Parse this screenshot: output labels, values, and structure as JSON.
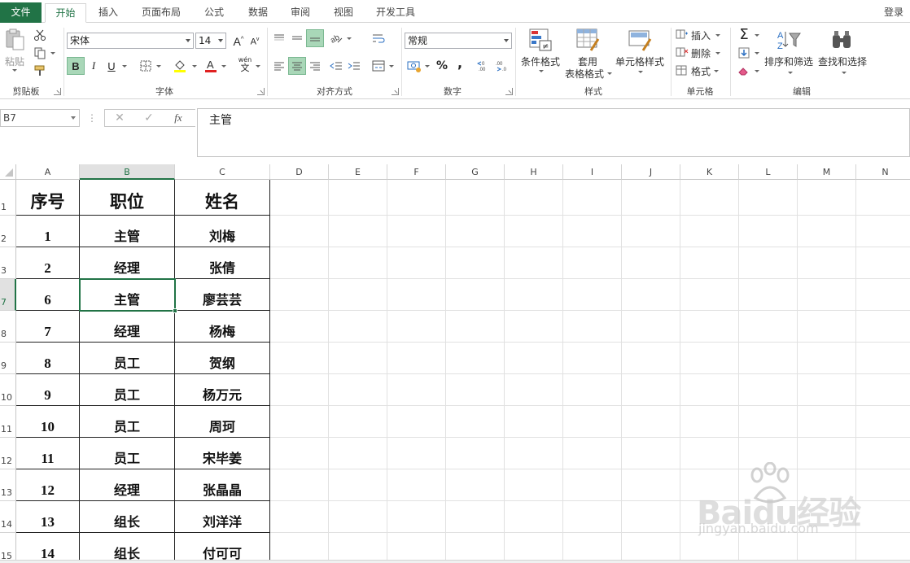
{
  "tabs": {
    "file": "文件",
    "items": [
      "开始",
      "插入",
      "页面布局",
      "公式",
      "数据",
      "审阅",
      "视图",
      "开发工具"
    ],
    "login": "登录"
  },
  "ribbon": {
    "clipboard": {
      "paste": "粘贴",
      "label": "剪贴板"
    },
    "font": {
      "name": "宋体",
      "size": "14",
      "bold": "B",
      "italic": "I",
      "underline": "U",
      "phonetic_top": "wén",
      "phonetic_bottom": "文",
      "label": "字体"
    },
    "alignment": {
      "label": "对齐方式"
    },
    "number": {
      "format": "常规",
      "percent": "%",
      "comma": ",",
      "label": "数字"
    },
    "styles": {
      "conditional": "条件格式",
      "table_line1": "套用",
      "table_line2": "表格格式",
      "cell_styles": "单元格样式",
      "label": "样式"
    },
    "cells": {
      "insert": "插入",
      "delete": "删除",
      "format": "格式",
      "label": "单元格"
    },
    "editing": {
      "sort": "排序和筛选",
      "find": "查找和选择",
      "label": "编辑"
    }
  },
  "formula_bar": {
    "name_box": "B7",
    "fx": "fx",
    "content": "主管"
  },
  "sheet": {
    "columns": [
      "A",
      "B",
      "C",
      "D",
      "E",
      "F",
      "G",
      "H",
      "I",
      "J",
      "K",
      "L",
      "M",
      "N"
    ],
    "selected_column": "B",
    "selected_row": "7",
    "rows": [
      {
        "row": "1",
        "a": "序号",
        "b": "职位",
        "c": "姓名"
      },
      {
        "row": "2",
        "a": "1",
        "b": "主管",
        "c": "刘梅"
      },
      {
        "row": "3",
        "a": "2",
        "b": "经理",
        "c": "张倩"
      },
      {
        "row": "7",
        "a": "6",
        "b": "主管",
        "c": "廖芸芸"
      },
      {
        "row": "8",
        "a": "7",
        "b": "经理",
        "c": "杨梅"
      },
      {
        "row": "9",
        "a": "8",
        "b": "员工",
        "c": "贺纲"
      },
      {
        "row": "10",
        "a": "9",
        "b": "员工",
        "c": "杨万元"
      },
      {
        "row": "11",
        "a": "10",
        "b": "员工",
        "c": "周珂"
      },
      {
        "row": "12",
        "a": "11",
        "b": "员工",
        "c": "宋毕姜"
      },
      {
        "row": "13",
        "a": "12",
        "b": "经理",
        "c": "张晶晶"
      },
      {
        "row": "14",
        "a": "13",
        "b": "组长",
        "c": "刘洋洋"
      },
      {
        "row": "15",
        "a": "14",
        "b": "组长",
        "c": "付可可"
      }
    ]
  },
  "watermark": {
    "logo": "Baidu经验",
    "sub": "jingyan.baidu.com"
  },
  "colors": {
    "accent": "#217346",
    "selected_fill": "#a9d7b8"
  }
}
